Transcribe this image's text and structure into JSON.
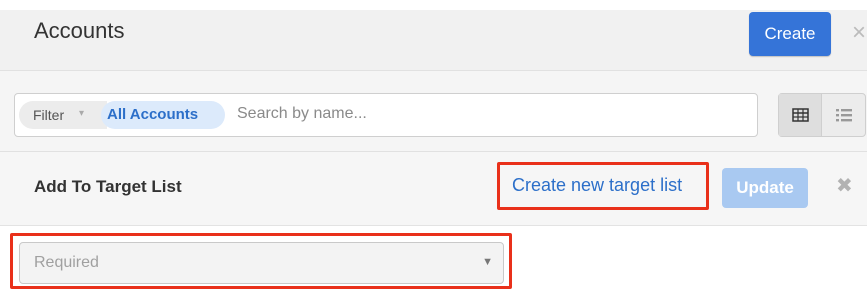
{
  "header": {
    "title": "Accounts",
    "create_label": "Create",
    "close_glyph": "×"
  },
  "filterbar": {
    "filter_label": "Filter",
    "filter_caret": "▾",
    "active_filter": "All Accounts",
    "search_placeholder": "Search by name...",
    "view_icons": [
      "table-view-icon",
      "list-view-icon"
    ]
  },
  "target_list": {
    "title": "Add To Target List",
    "create_link_label": "Create new target list",
    "update_label": "Update",
    "close_glyph": "✖",
    "select_placeholder": "Required",
    "select_caret": "▼"
  },
  "colors": {
    "primary": "#3574d8",
    "update_disabled": "#a9c9f1",
    "highlight": "#e9301a",
    "link": "#2c6fc9"
  }
}
